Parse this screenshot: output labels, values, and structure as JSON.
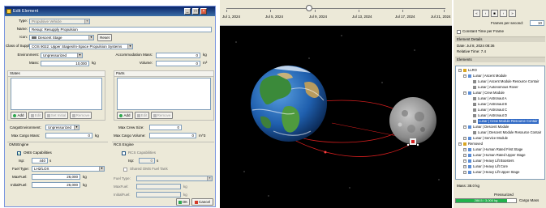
{
  "dialog": {
    "title": "Edit Element",
    "type_label": "Type:",
    "type_value": "Propulsive Vehicle",
    "name_label": "Name:",
    "name_value": "Resup: Resupply Propulsion",
    "icon_label": "Icon:",
    "icon_value": "Descent Stage",
    "reset_label": "Reset",
    "class_label": "Class of Supply:",
    "class_value": "COS 9022: Upper Stages/In-Space Propulsion Systems",
    "environment_label": "Environment:",
    "environment_value": "Unpressurized",
    "accommodation_label": "Accommodation Mass:",
    "accommodation_value": "0",
    "accommodation_unit": "kg",
    "mass_label": "Mass:",
    "mass_value": "10,000",
    "mass_unit": "kg",
    "volume_label": "Volume:",
    "volume_value": "0",
    "volume_unit": "m³",
    "states_label": "States",
    "parts_label": "Parts",
    "add_label": "Add",
    "edit_label": "Edit",
    "set_initial_label": "Set Initial",
    "remove_label": "Remove",
    "cargo_env_label": "CargoEnvironment:",
    "cargo_env_value": "Unpressurized",
    "max_crew_label": "Max Crew Size:",
    "max_crew_value": "0",
    "max_cargo_mass_label": "Max Cargo Mass:",
    "max_cargo_mass_value": "0",
    "max_cargo_mass_unit": "kg",
    "max_cargo_volume_label": "Max Cargo Volume:",
    "max_cargo_volume_value": "0",
    "max_cargo_volume_unit": "m^3",
    "oms_label": "OMSEngine",
    "rcs_label": "RCS Engine",
    "oms_capabilities_label": "OMS Capabilities",
    "rcs_capabilities_label": "RCS Capabilities",
    "isp_label": "Isp:",
    "oms_isp_value": "440",
    "rcs_isp_value": "0",
    "isp_unit": "s",
    "shared_tank_label": "Shared OMS Fuel Tank",
    "fuel_type_label": "Fuel Type:",
    "oms_fuel_type_value": "LH2/LOX",
    "rcs_fuel_type_value": "",
    "max_fuel_label": "MaxFuel:",
    "oms_max_fuel_value": "26,000",
    "rcs_max_fuel_value": "",
    "initial_fuel_label": "InitialFuel:",
    "oms_initial_fuel_value": "26,000",
    "rcs_initial_fuel_value": "",
    "kg_unit": "kg",
    "ok_label": "OK",
    "cancel_label": "Cancel"
  },
  "timeline": {
    "labels": [
      "Jul 1, 2024",
      "Jul 5, 2024",
      "Jul 9, 2024",
      "Jul 13, 2024",
      "Jul 17, 2024",
      "Jul 21, 2024"
    ]
  },
  "panel": {
    "buttons": [
      "«",
      "‹",
      "■",
      "›",
      "»"
    ],
    "frames_label": "Frames per second:",
    "frames_value": "10",
    "constant_time_label": "Constant Time per Frame",
    "element_details_label": "Element Details",
    "date_label": "Date: Jul 8, 2024 08:36",
    "relative_time_label": "Relative Time: 7.4",
    "elements_label": "Elements",
    "tree": [
      {
        "text": "LLRO",
        "level": 0
      },
      {
        "text": "Lunar | Ascent Module",
        "level": 1
      },
      {
        "text": "Lunar | Ascent Module Resource Contair",
        "level": 2
      },
      {
        "text": "Lunar | Autonomous Rover",
        "level": 2
      },
      {
        "text": "Lunar | Crew Module",
        "level": 1
      },
      {
        "text": "Lunar | Astronaut A",
        "level": 2
      },
      {
        "text": "Lunar | Astronaut B",
        "level": 2
      },
      {
        "text": "Lunar | Astronaut C",
        "level": 2
      },
      {
        "text": "Lunar | Astronaut D",
        "level": 2
      },
      {
        "text": "Lunar | Crew Module Resource Contair",
        "level": 2,
        "selected": true
      },
      {
        "text": "Lunar | Descent Module",
        "level": 1
      },
      {
        "text": "Lunar | Descent Module Resource Contair",
        "level": 2
      },
      {
        "text": "Lunar | Service Module",
        "level": 1
      },
      {
        "text": "Removed",
        "level": 0
      },
      {
        "text": "Lunar | Human Rated First Stage",
        "level": 1
      },
      {
        "text": "Lunar | Human Rated Upper Stage",
        "level": 1
      },
      {
        "text": "Lunar | Heavy Lift Boosters",
        "level": 1
      },
      {
        "text": "Lunar | Heavy Lift Core",
        "level": 1
      },
      {
        "text": "Lunar | Heavy Lift Upper Stage",
        "level": 1
      }
    ],
    "mass_label": "Mass: 38.0 kg",
    "pressurized_label": "Pressurized",
    "cargo_fill_text": "288.5 / 3,000 kg",
    "cargo_fraction": 0.85,
    "cargo_mass_label": "Cargo Mass"
  },
  "colors": {
    "title_bar": "#0a246a",
    "accent_green": "#22b14c",
    "selection": "#316ac5",
    "orbit_red": "#d41e1e"
  }
}
